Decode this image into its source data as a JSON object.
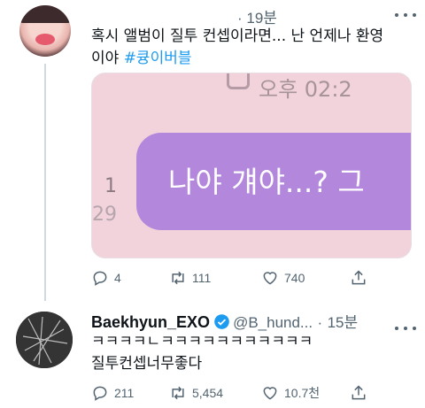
{
  "tweet1": {
    "time": "19분",
    "text_line1": "혹시 앨범이 질투 컨셉이라면... 난 언제나 환영",
    "text_line2_prefix": "이야 ",
    "hashtag": "#큥이버블",
    "media": {
      "time_label": "오후 02:2",
      "read_number": "1",
      "read_time": "29",
      "bubble_text": "나야 걔야...? 그"
    },
    "actions": {
      "replies": "4",
      "retweets": "111",
      "likes": "740"
    }
  },
  "tweet2": {
    "name": "Baekhyun_EXO",
    "handle": "@B_hund...",
    "separator": "·",
    "time": "15분",
    "text_line1": "ㅋㅋㅋㅋㄴㅋㅋㅋㅋㅋㅋㅋㅋㅋㅋㅋ",
    "text_line2": "질투컨셉너무좋다",
    "actions": {
      "replies": "211",
      "retweets": "5,454",
      "likes": "10.7천"
    }
  },
  "colors": {
    "accent": "#1d9bf0",
    "secondary_text": "#536471",
    "bubble": "#b387dc",
    "media_bg": "#f2d3db",
    "like_icon": "#536471"
  },
  "icons": [
    "reply-icon",
    "retweet-icon",
    "like-icon",
    "share-icon",
    "verified-icon",
    "more-icon"
  ]
}
